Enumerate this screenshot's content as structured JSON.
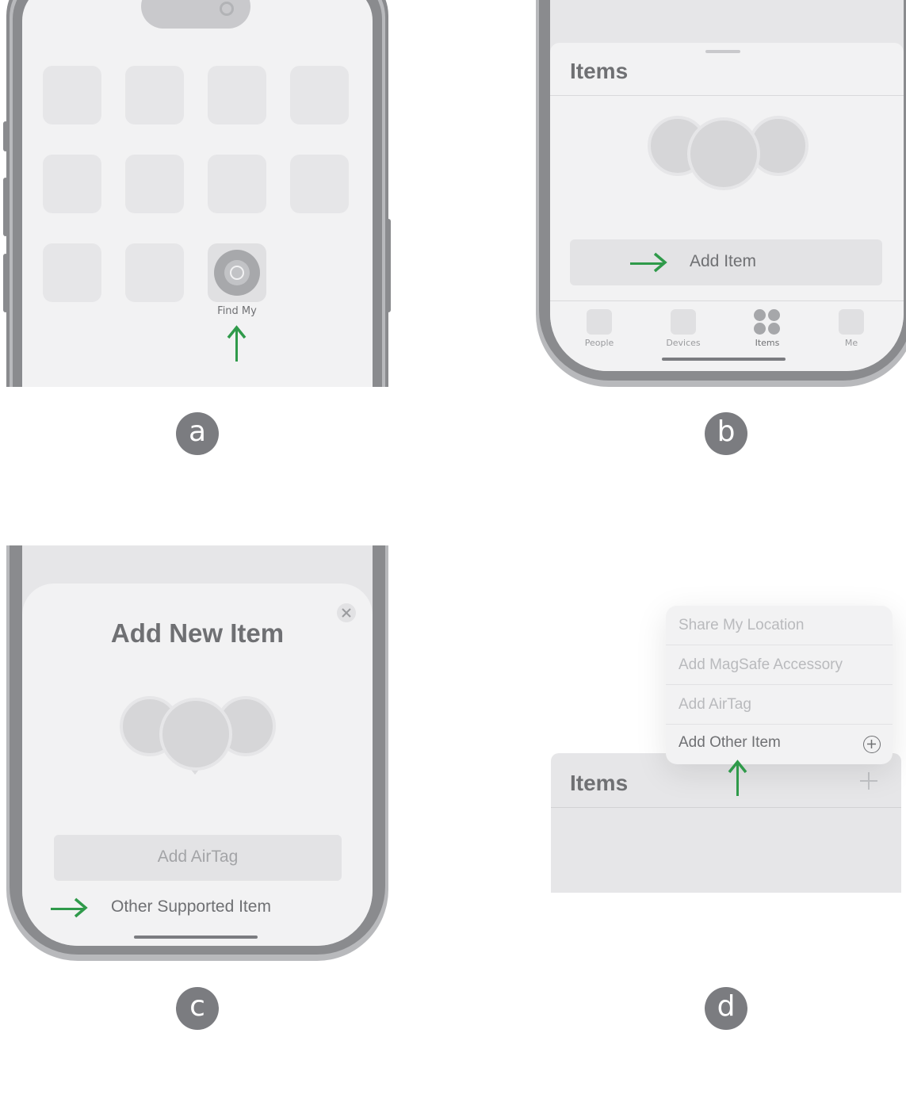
{
  "panels": {
    "a": {
      "label": "a",
      "app_name": "Find My"
    },
    "b": {
      "label": "b",
      "sheet_title": "Items",
      "add_item_label": "Add Item",
      "tabs": [
        "People",
        "Devices",
        "Items",
        "Me"
      ]
    },
    "c": {
      "label": "c",
      "title": "Add New Item",
      "add_airtag_label": "Add AirTag",
      "other_item_label": "Other Supported Item",
      "close_icon": "close-icon"
    },
    "d": {
      "label": "d",
      "menu_items": [
        "Share My Location",
        "Add MagSafe Accessory",
        "Add AirTag",
        "Add Other Item"
      ],
      "header_title": "Items",
      "add_icon": "plus-icon"
    }
  },
  "colors": {
    "arrow": "#2f9a4a",
    "frame": "#8a8b8e",
    "screen": "#f2f2f3",
    "label_circle": "#7b7c80"
  }
}
